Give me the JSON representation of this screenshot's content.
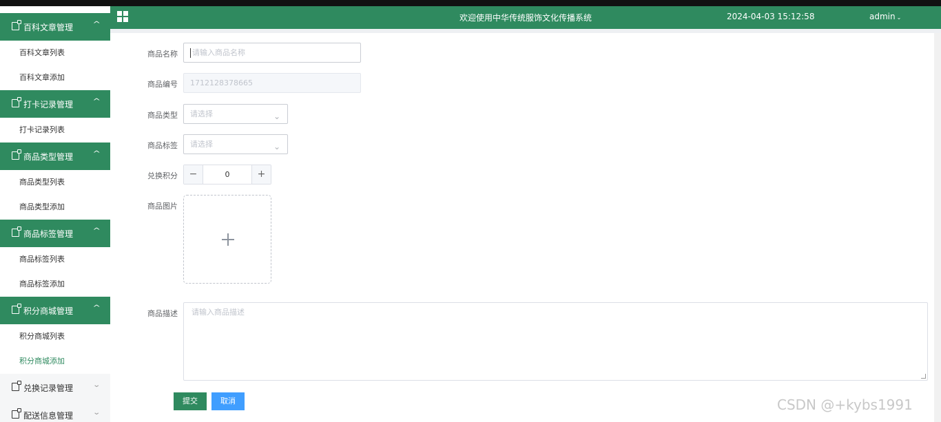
{
  "header": {
    "title": "欢迎使用中华传统服饰文化传播系统",
    "datetime": "2024-04-03 15:12:58",
    "user": "admin",
    "brand_color": "#2f8a5f"
  },
  "sidebar": {
    "groups": [
      {
        "label": "百科文章管理",
        "open": true,
        "items": [
          "百科文章列表",
          "百科文章添加"
        ]
      },
      {
        "label": "打卡记录管理",
        "open": true,
        "items": [
          "打卡记录列表"
        ]
      },
      {
        "label": "商品类型管理",
        "open": true,
        "items": [
          "商品类型列表",
          "商品类型添加"
        ]
      },
      {
        "label": "商品标签管理",
        "open": true,
        "items": [
          "商品标签列表",
          "商品标签添加"
        ]
      },
      {
        "label": "积分商城管理",
        "open": true,
        "items": [
          "积分商城列表",
          "积分商城添加"
        ]
      },
      {
        "label": "兑换记录管理",
        "open": false,
        "items": []
      },
      {
        "label": "配送信息管理",
        "open": false,
        "items": []
      }
    ],
    "active_item": "积分商城添加"
  },
  "form": {
    "name": {
      "label": "商品名称",
      "placeholder": "请输入商品名称",
      "value": ""
    },
    "code": {
      "label": "商品编号",
      "value": "1712128378665"
    },
    "type": {
      "label": "商品类型",
      "placeholder": "请选择"
    },
    "tag": {
      "label": "商品标签",
      "placeholder": "请选择"
    },
    "points": {
      "label": "兑换积分",
      "value": "0",
      "minus": "−",
      "plus": "+"
    },
    "image": {
      "label": "商品图片"
    },
    "desc": {
      "label": "商品描述",
      "placeholder": "请输入商品描述"
    },
    "submit_label": "提交",
    "cancel_label": "取消"
  },
  "watermark": "CSDN @+kybs1991"
}
